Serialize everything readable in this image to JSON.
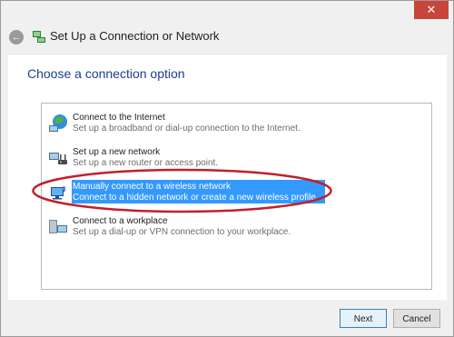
{
  "window": {
    "title": "Set Up a Connection or Network",
    "close_label": "✕",
    "back_label": "←"
  },
  "page": {
    "heading": "Choose a connection option"
  },
  "options": [
    {
      "title": "Connect to the Internet",
      "description": "Set up a broadband or dial-up connection to the Internet.",
      "icon": "globe-network-icon",
      "selected": false
    },
    {
      "title": "Set up a new network",
      "description": "Set up a new router or access point.",
      "icon": "router-network-icon",
      "selected": false
    },
    {
      "title": "Manually connect to a wireless network",
      "description": "Connect to a hidden network or create a new wireless profile.",
      "icon": "wireless-computer-icon",
      "selected": true
    },
    {
      "title": "Connect to a workplace",
      "description": "Set up a dial-up or VPN connection to your workplace.",
      "icon": "workplace-network-icon",
      "selected": false
    }
  ],
  "footer": {
    "next_label": "Next",
    "cancel_label": "Cancel"
  },
  "colors": {
    "selection": "#3399ff",
    "annotation_ellipse": "#c0202a",
    "heading": "#1b3f8f",
    "close_button": "#c7453a"
  }
}
